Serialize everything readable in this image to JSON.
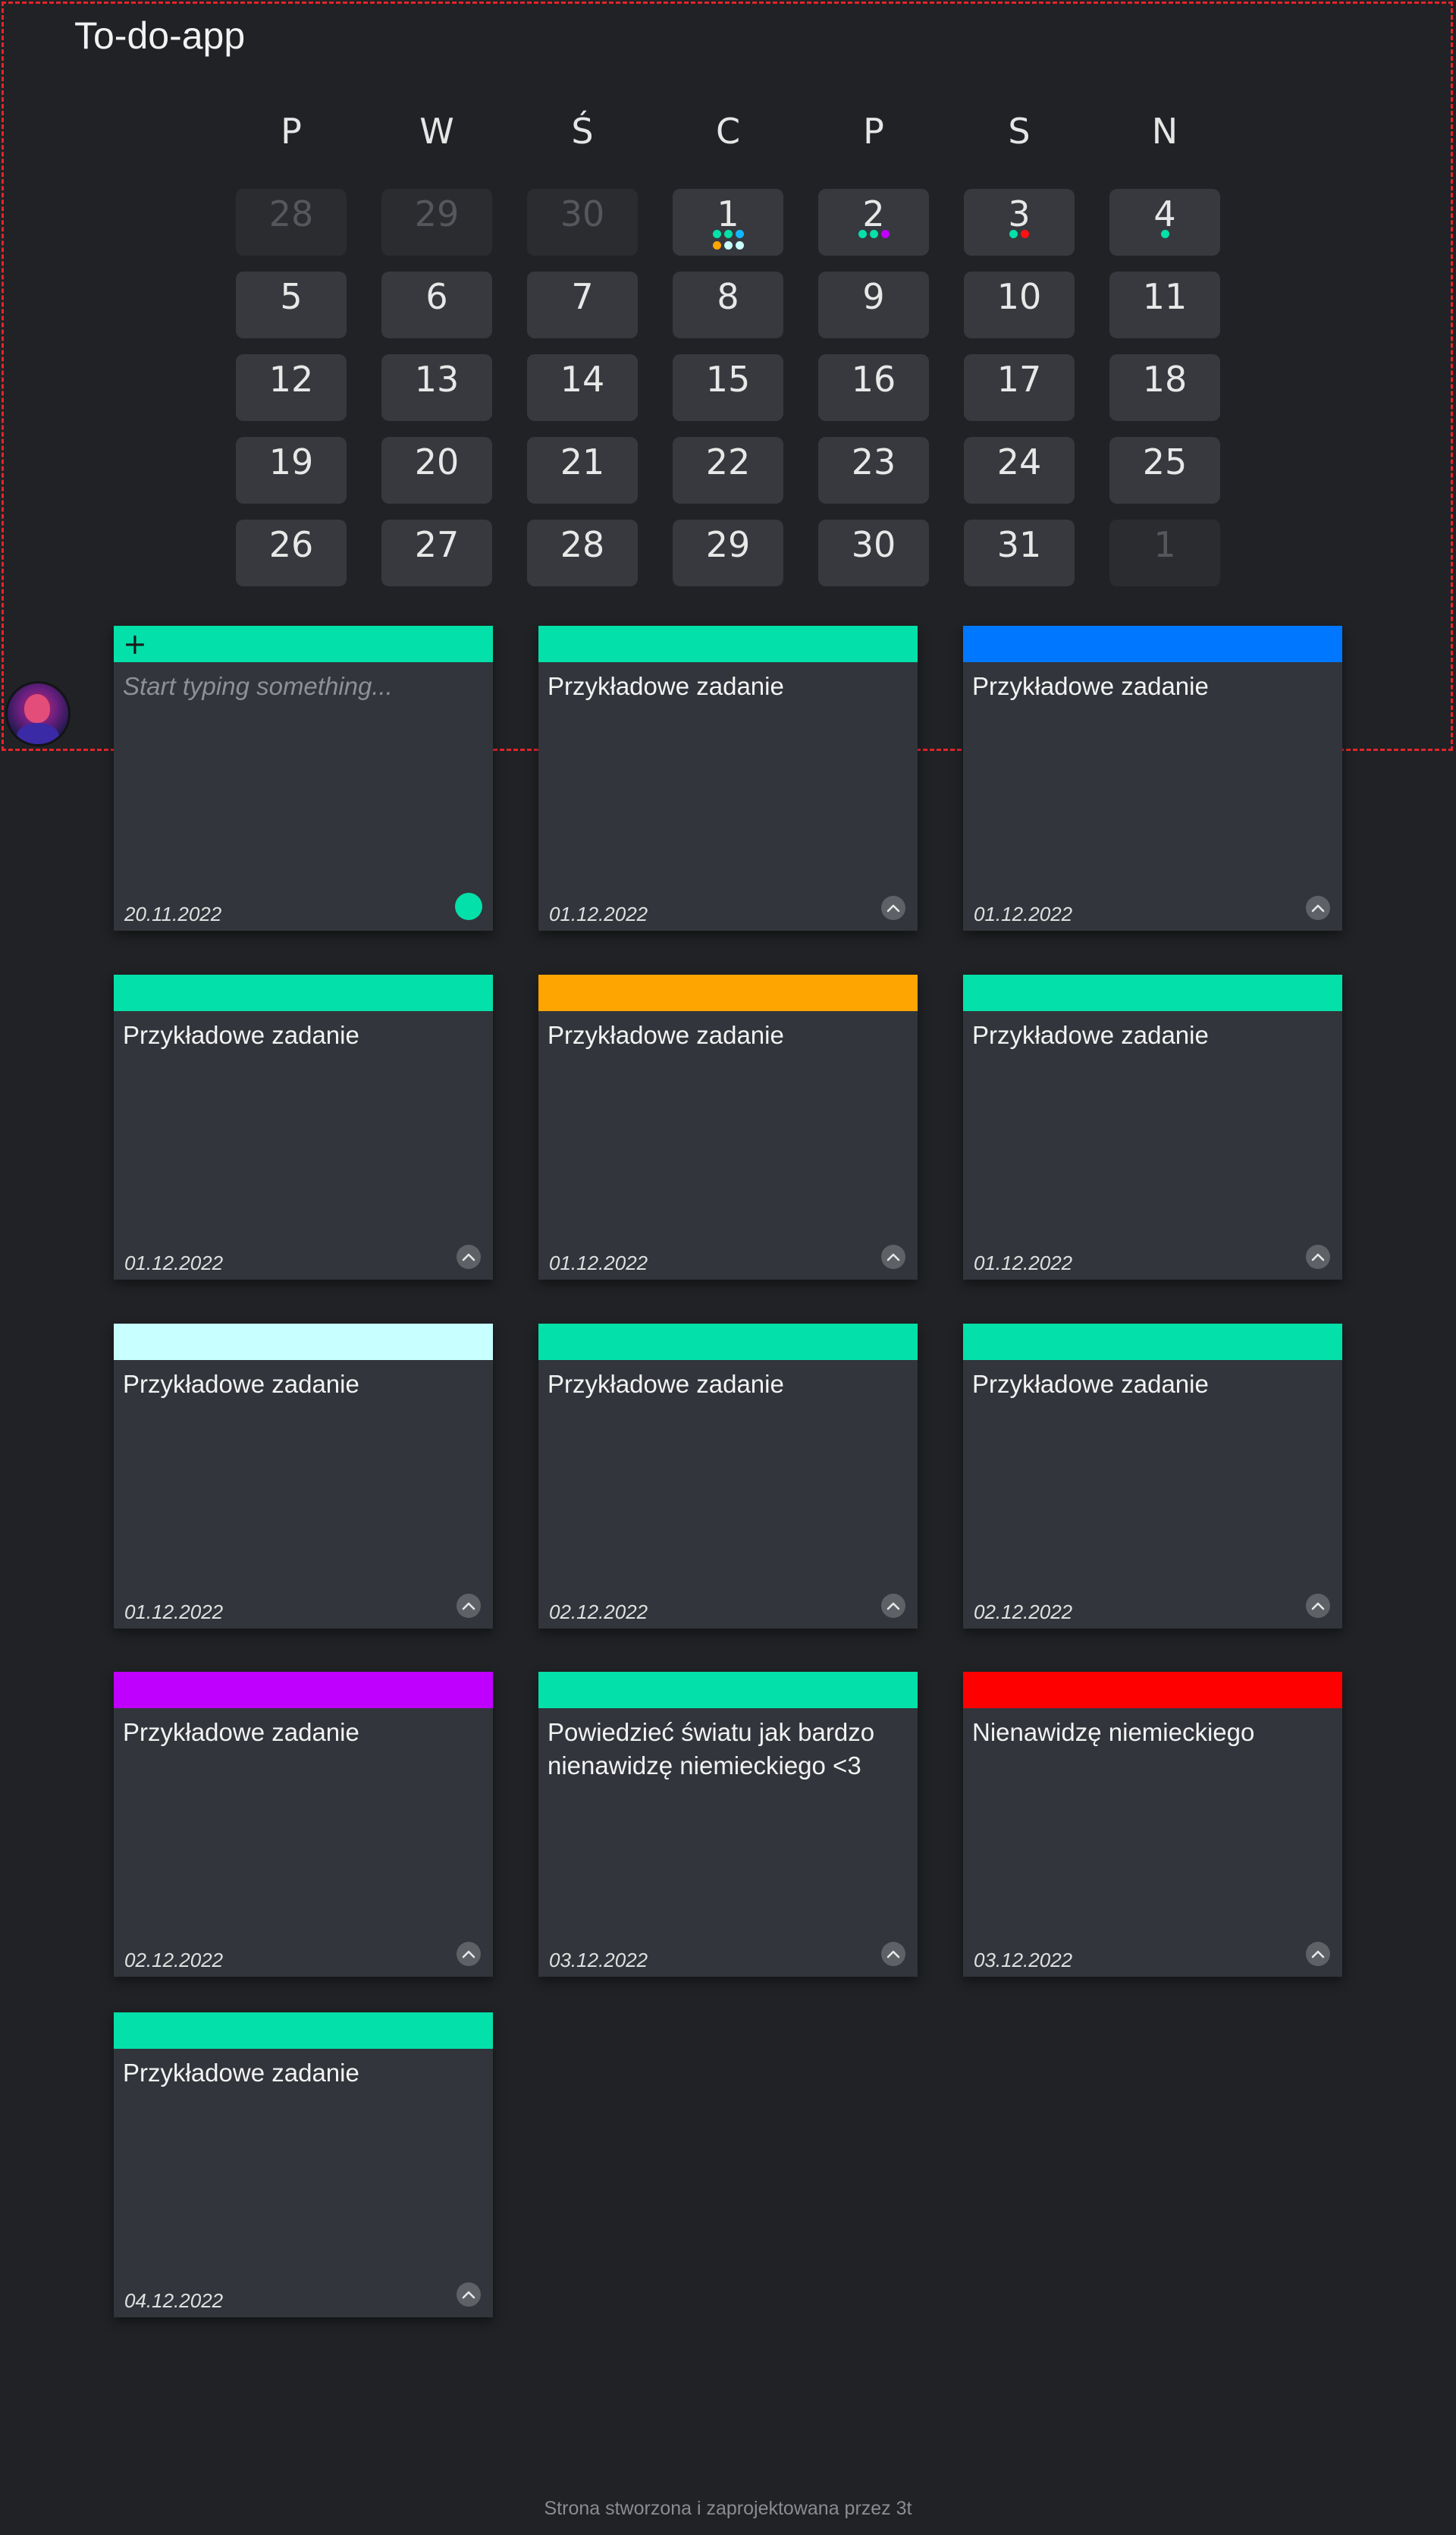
{
  "app": {
    "title": "To-do-app"
  },
  "calendar": {
    "weekdays": [
      "P",
      "W",
      "Ś",
      "C",
      "P",
      "S",
      "N"
    ],
    "weeks": [
      [
        {
          "label": "28",
          "muted": true,
          "dots": []
        },
        {
          "label": "29",
          "muted": true,
          "dots": []
        },
        {
          "label": "30",
          "muted": true,
          "dots": []
        },
        {
          "label": "1",
          "muted": false,
          "dots": [
            [
              "#04e0a9",
              "#04e0a9",
              "#11b8ff"
            ],
            [
              "#ffa502",
              "#c8ffff",
              "#c8ffff"
            ]
          ]
        },
        {
          "label": "2",
          "muted": false,
          "dots": [
            [
              "#04e0a9",
              "#04e0a9",
              "#bf00ff"
            ]
          ]
        },
        {
          "label": "3",
          "muted": false,
          "dots": [
            [
              "#04e0a9",
              "#ff1111"
            ]
          ]
        },
        {
          "label": "4",
          "muted": false,
          "dots": [
            [
              "#04e0a9"
            ]
          ]
        }
      ],
      [
        {
          "label": "5",
          "muted": false,
          "dots": []
        },
        {
          "label": "6",
          "muted": false,
          "dots": []
        },
        {
          "label": "7",
          "muted": false,
          "dots": []
        },
        {
          "label": "8",
          "muted": false,
          "dots": []
        },
        {
          "label": "9",
          "muted": false,
          "dots": []
        },
        {
          "label": "10",
          "muted": false,
          "dots": []
        },
        {
          "label": "11",
          "muted": false,
          "dots": []
        }
      ],
      [
        {
          "label": "12",
          "muted": false,
          "dots": []
        },
        {
          "label": "13",
          "muted": false,
          "dots": []
        },
        {
          "label": "14",
          "muted": false,
          "dots": []
        },
        {
          "label": "15",
          "muted": false,
          "dots": []
        },
        {
          "label": "16",
          "muted": false,
          "dots": []
        },
        {
          "label": "17",
          "muted": false,
          "dots": []
        },
        {
          "label": "18",
          "muted": false,
          "dots": []
        }
      ],
      [
        {
          "label": "19",
          "muted": false,
          "dots": []
        },
        {
          "label": "20",
          "muted": false,
          "dots": []
        },
        {
          "label": "21",
          "muted": false,
          "dots": []
        },
        {
          "label": "22",
          "muted": false,
          "dots": []
        },
        {
          "label": "23",
          "muted": false,
          "dots": []
        },
        {
          "label": "24",
          "muted": false,
          "dots": []
        },
        {
          "label": "25",
          "muted": false,
          "dots": []
        }
      ],
      [
        {
          "label": "26",
          "muted": false,
          "dots": []
        },
        {
          "label": "27",
          "muted": false,
          "dots": []
        },
        {
          "label": "28",
          "muted": false,
          "dots": []
        },
        {
          "label": "29",
          "muted": false,
          "dots": []
        },
        {
          "label": "30",
          "muted": false,
          "dots": []
        },
        {
          "label": "31",
          "muted": false,
          "dots": []
        },
        {
          "label": "1",
          "muted": true,
          "dots": []
        }
      ]
    ]
  },
  "new_task": {
    "placeholder": "Start typing something...",
    "date": "20.11.2022",
    "color": "#04e0a9",
    "add_icon": "plus-icon"
  },
  "tasks": [
    {
      "title": "Przykładowe zadanie",
      "date": "01.12.2022",
      "color": "#04e0a9"
    },
    {
      "title": "Przykładowe zadanie",
      "date": "01.12.2022",
      "color": "#0077ff"
    },
    {
      "title": "Przykładowe zadanie",
      "date": "01.12.2022",
      "color": "#04e0a9"
    },
    {
      "title": "Przykładowe zadanie",
      "date": "01.12.2022",
      "color": "#ffa502"
    },
    {
      "title": "Przykładowe zadanie",
      "date": "01.12.2022",
      "color": "#04e0a9"
    },
    {
      "title": "Przykładowe zadanie",
      "date": "01.12.2022",
      "color": "#c8ffff"
    },
    {
      "title": "Przykładowe zadanie",
      "date": "02.12.2022",
      "color": "#04e0a9"
    },
    {
      "title": "Przykładowe zadanie",
      "date": "02.12.2022",
      "color": "#04e0a9"
    },
    {
      "title": "Przykładowe zadanie",
      "date": "02.12.2022",
      "color": "#bf00ff"
    },
    {
      "title": "Powiedzieć światu jak bardzo nienawidzę niemieckiego <3",
      "date": "03.12.2022",
      "color": "#04e0a9"
    },
    {
      "title": "Nienawidzę niemieckiego",
      "date": "03.12.2022",
      "color": "#ff0000"
    },
    {
      "title": "Przykładowe zadanie",
      "date": "04.12.2022",
      "color": "#04e0a9"
    }
  ],
  "task_icon": "chevron-up-icon",
  "footer": {
    "text": "Strona stworzona i zaprojektowana przez 3t"
  }
}
